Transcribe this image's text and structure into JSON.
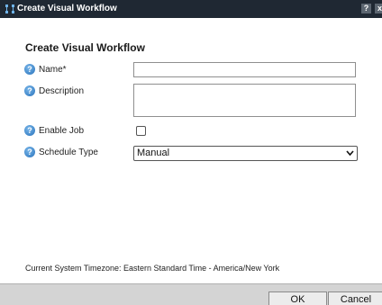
{
  "window": {
    "title": "Create Visual Workflow",
    "help_glyph": "?",
    "close_glyph": "x",
    "icon": "workflow-icon"
  },
  "form": {
    "heading": "Create Visual Workflow",
    "help_glyph": "?",
    "fields": {
      "name": {
        "label": "Name*",
        "value": ""
      },
      "description": {
        "label": "Description",
        "value": ""
      },
      "enable_job": {
        "label": "Enable Job",
        "checked": false
      },
      "schedule_type": {
        "label": "Schedule Type",
        "value": "Manual"
      }
    }
  },
  "timezone_text": "Current System Timezone: Eastern Standard Time - America/New York",
  "buttons": {
    "ok": "OK",
    "cancel": "Cancel"
  },
  "colors": {
    "titlebar": "#1f2833",
    "footer": "#d4d4d4",
    "help_icon": "#3f86c9"
  }
}
